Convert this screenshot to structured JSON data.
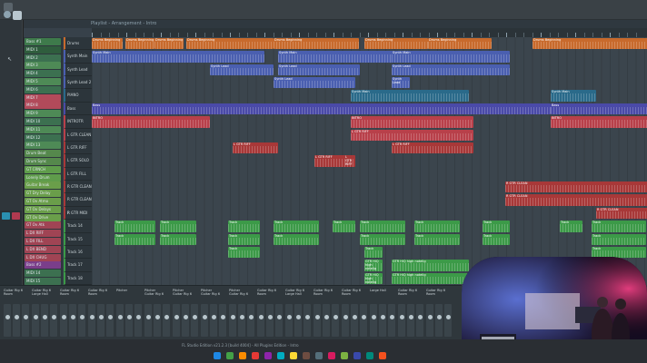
{
  "window": {
    "title": "Playlist - Arrangement - Intro",
    "status_bar": "FL Studio Edition v21.2.3 [build 4004] - All Plugins Edition - Intro"
  },
  "patterns": [
    {
      "label": "Bass #1",
      "color": "#3e7a4b"
    },
    {
      "label": "MIDI 1",
      "color": "#2f5d3d"
    },
    {
      "label": "MIDI 2",
      "color": "#3c7050"
    },
    {
      "label": "MIDI 3",
      "color": "#4e8a56"
    },
    {
      "label": "MIDI 4",
      "color": "#3c7050"
    },
    {
      "label": "MIDI 5",
      "color": "#4e8a56"
    },
    {
      "label": "MIDI 6",
      "color": "#3c7050"
    },
    {
      "label": "MIDI 7",
      "color": "#b24a5a"
    },
    {
      "label": "MIDI 8",
      "color": "#b24a5a"
    },
    {
      "label": "MIDI 9",
      "color": "#4e8a56"
    },
    {
      "label": "MIDI 10",
      "color": "#3c7050"
    },
    {
      "label": "MIDI 11",
      "color": "#4e8a56"
    },
    {
      "label": "MIDI 12",
      "color": "#3c7050"
    },
    {
      "label": "MIDI 13",
      "color": "#4e8a56"
    },
    {
      "label": "Drum Beat",
      "color": "#55884c"
    },
    {
      "label": "Drum Sync",
      "color": "#55884c"
    },
    {
      "label": "GT CRNCH",
      "color": "#5f9c4b"
    },
    {
      "label": "Lonely Drum",
      "color": "#5f9c4b"
    },
    {
      "label": "Guitar Break",
      "color": "#6a9e4a"
    },
    {
      "label": "GT Dry Delay",
      "color": "#6a9e4a"
    },
    {
      "label": "GT Ov Atmo",
      "color": "#6a9e4a"
    },
    {
      "label": "GT Ov Delays",
      "color": "#6a9e4a"
    },
    {
      "label": "GT Ov Drive",
      "color": "#6a9e4a"
    },
    {
      "label": "GT Ov Atk",
      "color": "#a04454"
    },
    {
      "label": "L DX RIFF",
      "color": "#a04454"
    },
    {
      "label": "L DX FILL",
      "color": "#a04454"
    },
    {
      "label": "L DX BEND",
      "color": "#a04454"
    },
    {
      "label": "L DX CHUG",
      "color": "#a04454"
    },
    {
      "label": "Bass #2",
      "color": "#7a3e8a"
    },
    {
      "label": "MIDI 14",
      "color": "#3c7050"
    },
    {
      "label": "MIDI 15",
      "color": "#3c7050"
    }
  ],
  "tracks": [
    {
      "label": "Drums",
      "color": "#c86a2c"
    },
    {
      "label": "Synth Main",
      "color": "#4a5fb0"
    },
    {
      "label": "Synth Lead",
      "color": "#4a5fb0"
    },
    {
      "label": "Synth Lead 2",
      "color": "#4a5fb0"
    },
    {
      "label": "PIANO",
      "color": "#2a6a8a"
    },
    {
      "label": "Bass",
      "color": "#4a4aa8"
    },
    {
      "label": "INTROTR",
      "color": "#b8404a"
    },
    {
      "label": "L GTR CLEAN",
      "color": "#b8404a"
    },
    {
      "label": "L GTR RIFF",
      "color": "#a83838"
    },
    {
      "label": "L GTR SOLO",
      "color": "#a83838"
    },
    {
      "label": "L GTR FILL",
      "color": "#a83838"
    },
    {
      "label": "R GTR CLEAN",
      "color": "#a83838"
    },
    {
      "label": "R GTR CLEAN R",
      "color": "#a83838"
    },
    {
      "label": "R GTR MIDI",
      "color": "#a83838"
    },
    {
      "label": "Track 14",
      "color": "#3c9a48"
    },
    {
      "label": "Track 15",
      "color": "#3c9a48"
    },
    {
      "label": "Track 16",
      "color": "#3c9a48"
    },
    {
      "label": "Track 17",
      "color": "#3c9a48"
    },
    {
      "label": "Track 18",
      "color": "#3c9a48"
    }
  ],
  "clips": {
    "drums": "Drums Beginning",
    "synth": "Synth Main",
    "synth_lead": "Synth Lead",
    "bass": "Bass",
    "intro": "INTRO",
    "riff": "L GTR RIFF",
    "clean": "R GTR CLEAN",
    "gtr_high": "GTR HiQ high notelig",
    "track": "Track"
  },
  "mixer": {
    "channels": [
      "Guitar Rig 6 Room",
      "Guitar Rig 6 Large Hall",
      "Guitar Rig 6 Room",
      "Guitar Rig 6 Room",
      "Pitcher",
      "Pitcher Guitar Rig 6",
      "Pitcher Guitar Rig 6",
      "Pitcher Guitar Rig 6",
      "Pitcher Guitar Rig 6",
      "Guitar Rig 6 Room",
      "Guitar Rig 6 Large Hall",
      "Guitar Rig 6 Room",
      "Guitar Rig 6 Room",
      "Large Hall",
      "Guitar Rig 6 Room",
      "Guitar Rig 6 Room"
    ]
  }
}
